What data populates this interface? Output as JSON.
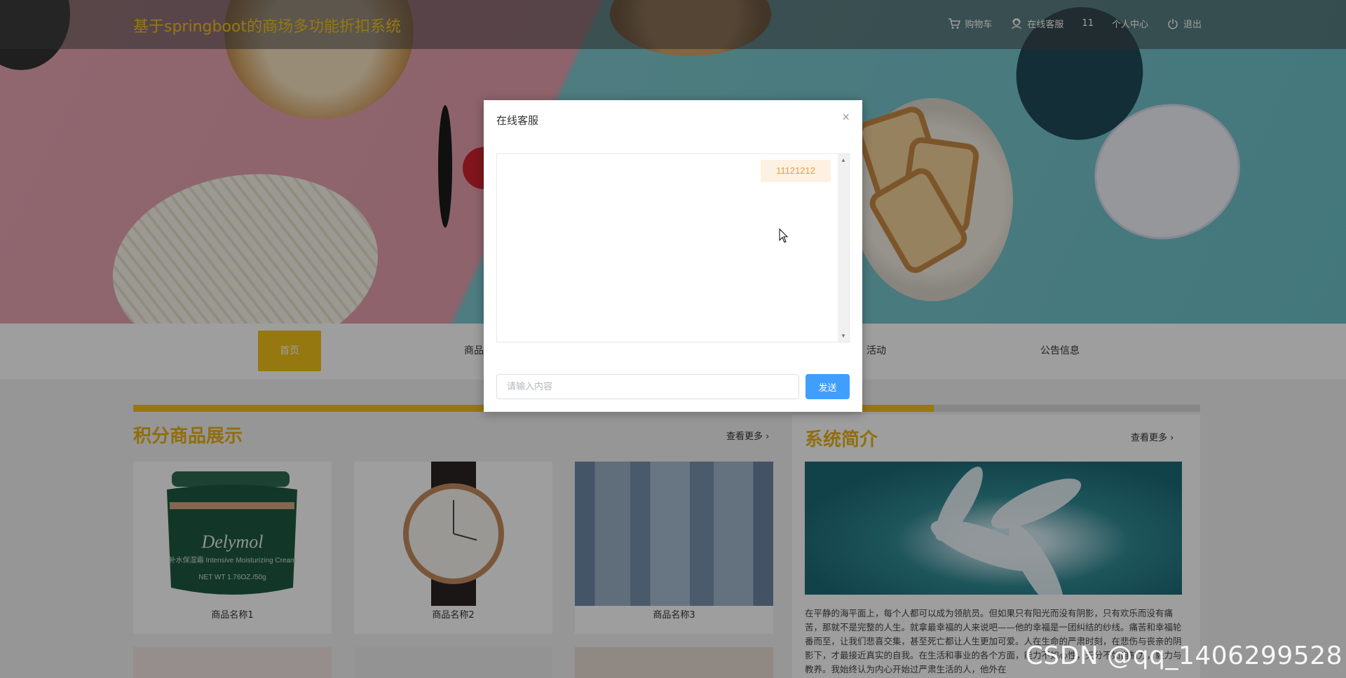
{
  "header": {
    "site_title": "基于springboot的商场多功能折扣系统",
    "nav": [
      {
        "label": "购物车",
        "icon": "cart-icon"
      },
      {
        "label": "在线客服",
        "icon": "support-agent-icon"
      },
      {
        "label": "11",
        "icon": ""
      },
      {
        "label": "个人中心",
        "icon": ""
      },
      {
        "label": "退出",
        "icon": "power-icon"
      }
    ]
  },
  "menu": {
    "items": [
      "首页",
      "商品信息",
      "活动",
      "公告信息"
    ]
  },
  "progress": {
    "fill_fraction": 0.75
  },
  "points_section": {
    "title": "积分商品展示",
    "more": "查看更多",
    "products": [
      {
        "name": "商品名称1",
        "image_text": "Delymol",
        "image_sub": "补水保湿霜 Intensive Moisturizing Cream",
        "image_net": "NET WT 1.76OZ./50g"
      },
      {
        "name": "商品名称2"
      },
      {
        "name": "商品名称3"
      }
    ]
  },
  "intro_section": {
    "title": "系统简介",
    "more": "查看更多",
    "text": "在平静的海平面上，每个人都可以成为领航员。但如果只有阳光而没有阴影，只有欢乐而没有痛苦，那就不是完整的人生。就拿最幸福的人来说吧——他的幸福是一团纠结的纱线。痛苦和幸福轮番而至，让我们悲喜交集，甚至死亡都让人生更加可爱。人在生命的严肃时刻，在悲伤与丧亲的阴影下，才最接近真实的自我。在生活和事业的各个方面，能力不如心性，天分不如自制力，毅力与教养。我始终认为内心开始过严肃生活的人，他外在"
  },
  "dialog": {
    "title": "在线客服",
    "close": "×",
    "messages": [
      "11121212"
    ],
    "input_placeholder": "请输入内容",
    "send_label": "发送"
  },
  "watermark": "CSDN @qq_1406299528",
  "colors": {
    "accent": "#f3c21c",
    "send_button": "#409eff",
    "message_bg": "#fdf1e1",
    "message_text": "#e0a04a"
  }
}
